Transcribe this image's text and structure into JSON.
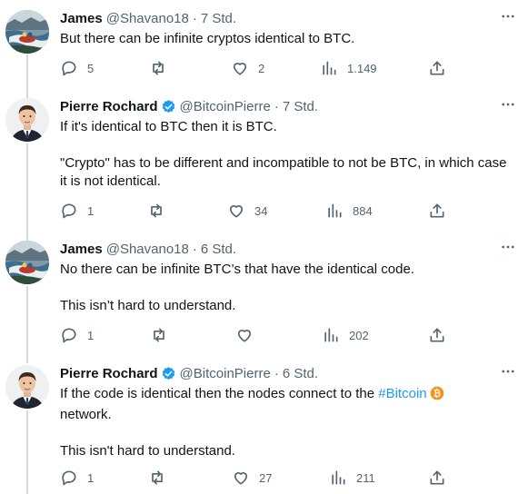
{
  "tweets": [
    {
      "name": "James",
      "handle": "@Shavano18",
      "separator": "·",
      "time": "7 Std.",
      "verified": false,
      "paragraphs": [
        "But there can be infinite cryptos identical to BTC."
      ],
      "replies": "5",
      "retweets": "",
      "likes": "2",
      "views": "1.149"
    },
    {
      "name": "Pierre Rochard",
      "handle": "@BitcoinPierre",
      "separator": "·",
      "time": "7 Std.",
      "verified": true,
      "paragraphs": [
        "If it's identical to BTC then it is BTC.",
        "\"Crypto\" has to be different and incompatible to not be BTC, in which case it is not identical."
      ],
      "replies": "1",
      "retweets": "",
      "likes": "34",
      "views": "884"
    },
    {
      "name": "James",
      "handle": "@Shavano18",
      "separator": "·",
      "time": "6 Std.",
      "verified": false,
      "paragraphs": [
        "No there can be infinite BTC’s that have the identical code.",
        "This isn’t hard to understand."
      ],
      "replies": "1",
      "retweets": "",
      "likes": "",
      "views": "202"
    },
    {
      "name": "Pierre Rochard",
      "handle": "@BitcoinPierre",
      "separator": "·",
      "time": "6 Std.",
      "verified": true,
      "paragraph1_before": "If the code is identical then the nodes connect to the ",
      "hashtag": "#Bitcoin",
      "paragraph1_after": "network.",
      "paragraph2": "This isn't hard to understand.",
      "replies": "1",
      "retweets": "",
      "likes": "27",
      "views": "211"
    }
  ],
  "icons": {
    "more": "more-horizontal-icon",
    "reply": "reply-icon",
    "retweet": "retweet-icon",
    "like": "heart-icon",
    "views": "views-chart-icon",
    "share": "share-icon",
    "verified": "verified-badge-icon",
    "bitcoin_emoji": "bitcoin-emoji-icon"
  },
  "colors": {
    "text": "#0f1419",
    "secondary": "#536471",
    "verified": "#1d9bf0",
    "hashtag": "#1d9bf0",
    "thread_line": "#cfd9de",
    "bitcoin": "#f7931a"
  }
}
